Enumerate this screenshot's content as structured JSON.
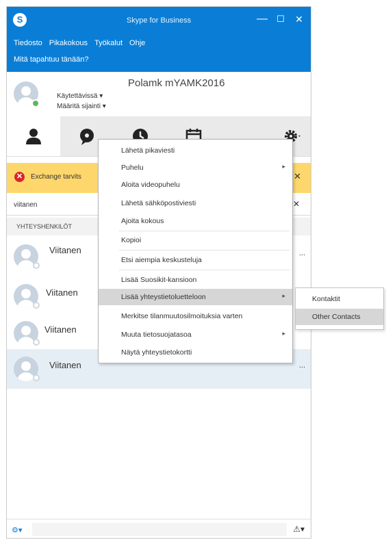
{
  "window": {
    "title": "Skype for Business",
    "controls": {
      "minimize": "—",
      "maximize": "☐",
      "close": "✕"
    }
  },
  "menubar": [
    "Tiedosto",
    "Pikakokous",
    "Työkalut",
    "Ohje"
  ],
  "whats_happening": "Mitä tapahtuu tänään?",
  "profile": {
    "name": "Polamk mYAMK2016",
    "status": "Käytettävissä ▾",
    "location": "Määritä sijainti ▾"
  },
  "banner": {
    "icon": "✕",
    "text": "Exchange tarvits",
    "close": "✕"
  },
  "search": {
    "value": "viitanen",
    "clear": "✕"
  },
  "group_header": "YHTEYSHENKILÖT",
  "contacts": [
    {
      "name": "Viitanen",
      "extra": "..."
    },
    {
      "name": "Viitanen",
      "extra": ""
    },
    {
      "name": "Viitanen",
      "extra": ""
    },
    {
      "name": "Viitanen",
      "extra": "..."
    }
  ],
  "context_menu": {
    "items": [
      {
        "label": "Lähetä pikaviesti"
      },
      {
        "label": "Puhelu",
        "arrow": "▸"
      },
      {
        "label": "Aloita videopuhelu"
      },
      {
        "label": "Lähetä sähköpostiviesti"
      },
      {
        "label": "Ajoita kokous"
      },
      {
        "label": "Kopioi"
      },
      {
        "label": "Etsi aiempia keskusteluja"
      },
      {
        "label": "Lisää Suosikit-kansioon"
      },
      {
        "label": "Lisää yhteystietoluetteloon",
        "arrow": "▸"
      },
      {
        "label": "Merkitse tilanmuutosilmoituksia varten"
      },
      {
        "label": "Muuta tietosuojatasoa",
        "arrow": "▸"
      },
      {
        "label": "Näytä yhteystietokortti"
      }
    ]
  },
  "submenu": {
    "items": [
      "Kontaktit",
      "Other Contacts"
    ]
  },
  "footer": {
    "left_icon": "⚙▾",
    "right_icon": "⚠▾"
  },
  "colors": {
    "accent": "#0a7ed6",
    "banner": "#fdd76b",
    "error": "#d9252a",
    "presence": "#5cb85c"
  },
  "icons": [
    "skype-logo-icon",
    "contacts-tab-icon",
    "conversations-tab-icon",
    "meetings-tab-icon",
    "calendar-tab-icon",
    "settings-gear-icon"
  ]
}
